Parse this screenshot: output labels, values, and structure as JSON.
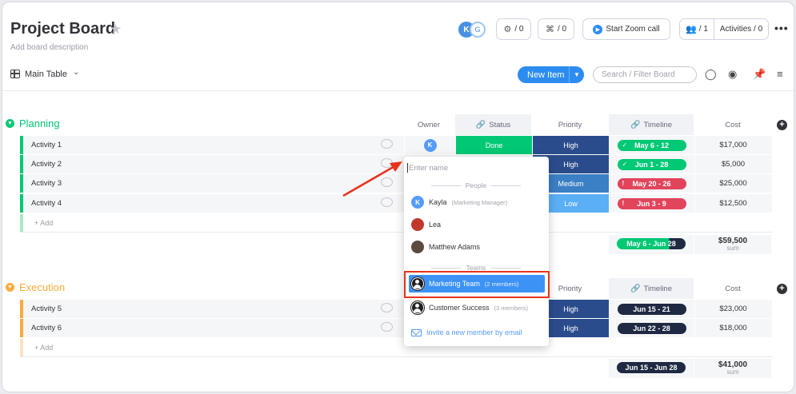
{
  "header": {
    "title": "Project Board",
    "description": "Add board description",
    "avatar_initial": "K",
    "guest_badge": "G",
    "automations_count": "/ 0",
    "integrations_count": "/ 0",
    "zoom_label": "Start Zoom call",
    "members_count": "/ 1",
    "activities_label": "Activities / 0"
  },
  "toolbar": {
    "view_label": "Main Table",
    "new_item_label": "New Item",
    "search_placeholder": "Search / Filter Board"
  },
  "groups": [
    {
      "title": "Planning",
      "color": "#00c875",
      "columns": {
        "owner": "Owner",
        "status": "Status",
        "priority": "Priority",
        "timeline": "Timeline",
        "cost": "Cost"
      },
      "rows": [
        {
          "name": "Activity 1",
          "status": "Done",
          "priority": "High",
          "timeline": "May 6 - 12",
          "cost": "$17,000"
        },
        {
          "name": "Activity 2",
          "status": "",
          "priority": "High",
          "timeline": "Jun 1 - 28",
          "cost": "$5,000"
        },
        {
          "name": "Activity 3",
          "status": "",
          "priority": "Medium",
          "timeline": "May 20 - 26",
          "cost": "$25,000"
        },
        {
          "name": "Activity 4",
          "status": "",
          "priority": "Low",
          "timeline": "Jun 3 - 9",
          "cost": "$12,500"
        }
      ],
      "add_label": "+ Add",
      "summary_timeline": "May 6 - Jun 28",
      "summary_cost": "$59,500",
      "summary_label": "sum"
    },
    {
      "title": "Execution",
      "color": "#fdab3d",
      "columns": {
        "priority": "Priority",
        "timeline": "Timeline",
        "cost": "Cost"
      },
      "rows": [
        {
          "name": "Activity 5",
          "priority": "High",
          "timeline": "Jun 15 - 21",
          "cost": "$23,000"
        },
        {
          "name": "Activity 6",
          "priority": "High",
          "timeline": "Jun 22 - 28",
          "cost": "$18,000"
        }
      ],
      "add_label": "+ Add",
      "summary_timeline": "Jun 15 - Jun 28",
      "summary_cost": "$41,000",
      "summary_label": "sum"
    }
  ],
  "owner_dropdown": {
    "placeholder": "Enter name",
    "people_heading": "People",
    "people": [
      {
        "name": "Kayla",
        "role": "(Marketing Manager)",
        "initial": "K"
      },
      {
        "name": "Lea",
        "role": ""
      },
      {
        "name": "Matthew Adams",
        "role": ""
      }
    ],
    "teams_heading": "Teams",
    "teams": [
      {
        "name": "Marketing Team",
        "members": "(2 members)"
      },
      {
        "name": "Customer Success",
        "members": "(3 members)"
      }
    ],
    "invite_label": "Invite a new member by email"
  },
  "colors": {
    "done": "#00c875",
    "high": "#2b4c8c",
    "medium": "#3b7fc4",
    "low": "#5aaff5",
    "timeline_green": "#00c875",
    "timeline_red": "#e2445c",
    "timeline_dark": "#1f2942",
    "accent": "#2d8cf0",
    "annotation": "#e8331c"
  }
}
